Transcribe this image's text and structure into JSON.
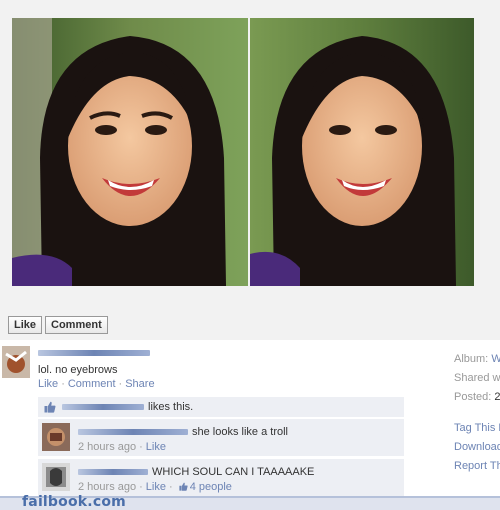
{
  "photo": {
    "images": [
      "portrait-original",
      "portrait-no-eyebrows"
    ]
  },
  "actions": {
    "like_label": "Like",
    "comment_label": "Comment"
  },
  "post": {
    "text": "lol. no eyebrows",
    "links": {
      "like": "Like",
      "comment": "Comment",
      "share": "Share"
    },
    "likes_text": "likes this."
  },
  "comments": [
    {
      "text": "she looks like a troll",
      "time": "2 hours ago",
      "like": "Like"
    },
    {
      "text": "WHICH SOUL CAN I TAAAAAKE",
      "time": "2 hours ago",
      "like": "Like",
      "likes_count": "4 people"
    }
  ],
  "sidebar": {
    "album_label": "Album:",
    "album_value": "W",
    "shared_label": "Shared wi",
    "posted_label": "Posted:",
    "posted_value": "2",
    "links": [
      "Tag This F",
      "Download",
      "Report Thi"
    ]
  },
  "footer": {
    "brand": "failbook.com"
  },
  "colors": {
    "link": "#6d84b4",
    "panel": "#edeff4",
    "brand": "#4a6ea9"
  }
}
